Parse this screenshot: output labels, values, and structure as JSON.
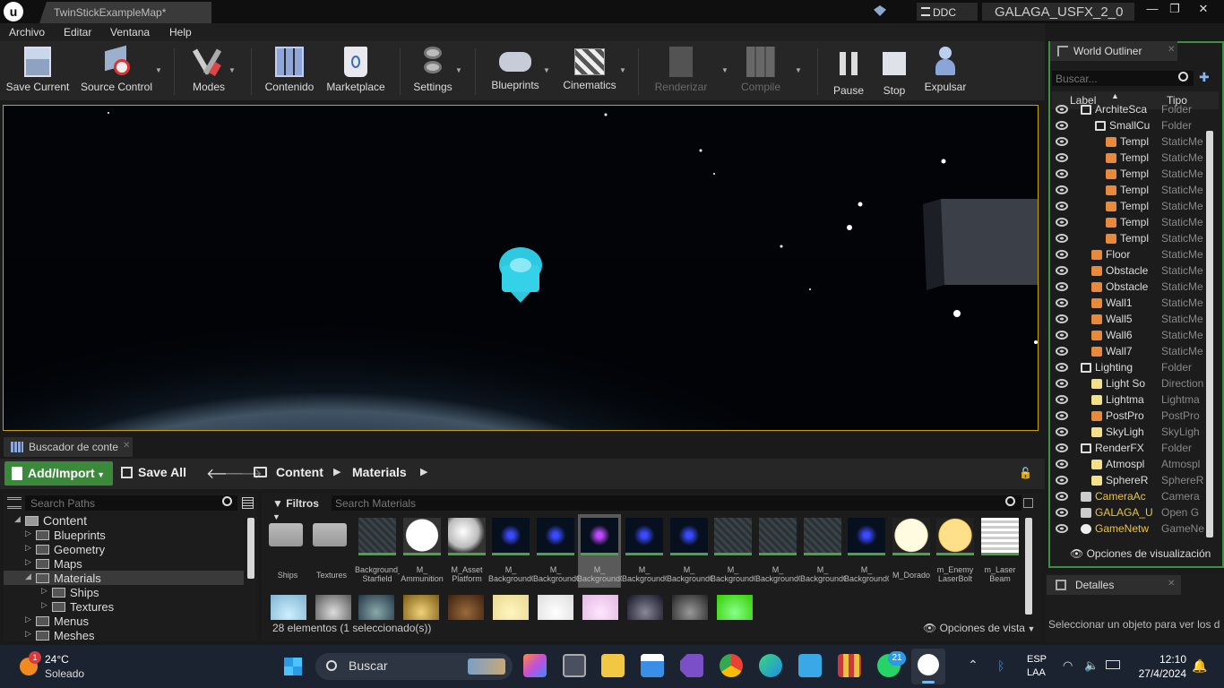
{
  "window": {
    "tab_title": "TwinStickExampleMap*",
    "ddc_label": "DDC",
    "project_name": "GALAGA_USFX_2_0",
    "minimize": "—",
    "maximize": "❐",
    "close": "✕"
  },
  "menu": [
    "Archivo",
    "Editar",
    "Ventana",
    "Help"
  ],
  "toolbar": {
    "save_current": "Save Current",
    "source_control": "Source Control",
    "modes": "Modes",
    "contenido": "Contenido",
    "marketplace": "Marketplace",
    "settings": "Settings",
    "blueprints": "Blueprints",
    "cinematics": "Cinematics",
    "renderizar": "Renderizar",
    "compile": "Compile",
    "pause": "Pause",
    "stop": "Stop",
    "expulsar": "Expulsar"
  },
  "content_browser": {
    "tab_label": "Buscador de conte",
    "add_import": "Add/Import",
    "save_all": "Save All",
    "breadcrumb": [
      "Content",
      "Materials"
    ],
    "search_paths_placeholder": "Search Paths",
    "filters_label": "Filtros",
    "search_materials_placeholder": "Search Materials",
    "tree": [
      {
        "label": "Content",
        "level": 0,
        "selected": false
      },
      {
        "label": "Blueprints",
        "level": 1,
        "selected": false
      },
      {
        "label": "Geometry",
        "level": 1,
        "selected": false
      },
      {
        "label": "Maps",
        "level": 1,
        "selected": false
      },
      {
        "label": "Materials",
        "level": 1,
        "selected": true
      },
      {
        "label": "Ships",
        "level": 2,
        "selected": false
      },
      {
        "label": "Textures",
        "level": 2,
        "selected": false
      },
      {
        "label": "Menus",
        "level": 1,
        "selected": false
      },
      {
        "label": "Meshes",
        "level": 1,
        "selected": false
      }
    ],
    "assets": [
      {
        "l1": "Ships",
        "l2": "",
        "kind": "folder"
      },
      {
        "l1": "Textures",
        "l2": "",
        "kind": "folder"
      },
      {
        "l1": "Background_",
        "l2": "Starfield",
        "kind": "grid"
      },
      {
        "l1": "M_",
        "l2": "Ammunition",
        "kind": "white"
      },
      {
        "l1": "M_Asset",
        "l2": "Platform",
        "kind": "sphere"
      },
      {
        "l1": "M_",
        "l2": "Background0",
        "kind": "space"
      },
      {
        "l1": "M_",
        "l2": "Background02",
        "kind": "space"
      },
      {
        "l1": "M_",
        "l2": "Background0",
        "kind": "spaceSel"
      },
      {
        "l1": "M_",
        "l2": "Background04",
        "kind": "space"
      },
      {
        "l1": "M_",
        "l2": "Background05",
        "kind": "space"
      },
      {
        "l1": "M_",
        "l2": "Background06",
        "kind": "grid"
      },
      {
        "l1": "M_",
        "l2": "Background07",
        "kind": "grid"
      },
      {
        "l1": "M_",
        "l2": "Background08",
        "kind": "grid"
      },
      {
        "l1": "M_",
        "l2": "Background09",
        "kind": "space"
      },
      {
        "l1": "M_Dorado",
        "l2": "",
        "kind": "cream"
      },
      {
        "l1": "m_Enemy",
        "l2": "LaserBolt",
        "kind": "yellow"
      },
      {
        "l1": "m_Laser",
        "l2": "Beam",
        "kind": "stripe"
      }
    ],
    "status": "28 elementos (1 seleccionado(s))",
    "view_options": "Opciones de vista"
  },
  "outliner": {
    "tab_label": "World Outliner",
    "search_placeholder": "Buscar...",
    "col_label": "Label",
    "col_type": "Tipo",
    "rows": [
      {
        "label": "ArchiteSca",
        "type": "Folder",
        "indent": 48,
        "icon": "folder"
      },
      {
        "label": "SmallCu",
        "type": "Folder",
        "indent": 64,
        "icon": "folder"
      },
      {
        "label": "Templ",
        "type": "StaticMe",
        "indent": 76,
        "icon": "mesh"
      },
      {
        "label": "Templ",
        "type": "StaticMe",
        "indent": 76,
        "icon": "mesh"
      },
      {
        "label": "Templ",
        "type": "StaticMe",
        "indent": 76,
        "icon": "mesh"
      },
      {
        "label": "Templ",
        "type": "StaticMe",
        "indent": 76,
        "icon": "mesh"
      },
      {
        "label": "Templ",
        "type": "StaticMe",
        "indent": 76,
        "icon": "mesh"
      },
      {
        "label": "Templ",
        "type": "StaticMe",
        "indent": 76,
        "icon": "mesh"
      },
      {
        "label": "Templ",
        "type": "StaticMe",
        "indent": 76,
        "icon": "mesh"
      },
      {
        "label": "Floor",
        "type": "StaticMe",
        "indent": 60,
        "icon": "mesh"
      },
      {
        "label": "Obstacle",
        "type": "StaticMe",
        "indent": 60,
        "icon": "mesh"
      },
      {
        "label": "Obstacle",
        "type": "StaticMe",
        "indent": 60,
        "icon": "mesh"
      },
      {
        "label": "Wall1",
        "type": "StaticMe",
        "indent": 60,
        "icon": "mesh"
      },
      {
        "label": "Wall5",
        "type": "StaticMe",
        "indent": 60,
        "icon": "mesh"
      },
      {
        "label": "Wall6",
        "type": "StaticMe",
        "indent": 60,
        "icon": "mesh"
      },
      {
        "label": "Wall7",
        "type": "StaticMe",
        "indent": 60,
        "icon": "mesh"
      },
      {
        "label": "Lighting",
        "type": "Folder",
        "indent": 48,
        "icon": "folder"
      },
      {
        "label": "Light So",
        "type": "Direction",
        "indent": 60,
        "icon": "light"
      },
      {
        "label": "Lightma",
        "type": "Lightma",
        "indent": 60,
        "icon": "light"
      },
      {
        "label": "PostPro",
        "type": "PostPro",
        "indent": 60,
        "icon": "mesh"
      },
      {
        "label": "SkyLigh",
        "type": "SkyLigh",
        "indent": 60,
        "icon": "light"
      },
      {
        "label": "RenderFX",
        "type": "Folder",
        "indent": 48,
        "icon": "folder"
      },
      {
        "label": "Atmospl",
        "type": "Atmospl",
        "indent": 60,
        "icon": "light"
      },
      {
        "label": "SphereR",
        "type": "SphereR",
        "indent": 60,
        "icon": "light"
      },
      {
        "label": "CameraAc",
        "type": "Camera",
        "indent": 48,
        "icon": "camera",
        "color": "#e8c34a"
      },
      {
        "label": "GALAGA_U",
        "type": "Open G",
        "indent": 48,
        "icon": "camera",
        "color": "#e8c34a"
      },
      {
        "label": "GameNetw",
        "type": "GameNe",
        "indent": 48,
        "icon": "sphere",
        "color": "#e8c34a"
      }
    ],
    "view_options": "Opciones de visualización"
  },
  "details": {
    "tab_label": "Detalles",
    "message": "Seleccionar un objeto para ver los d"
  },
  "taskbar": {
    "weather_temp": "24°C",
    "weather_desc": "Soleado",
    "weather_badge": "1",
    "search_label": "Buscar",
    "whatsapp_badge": "21",
    "lang_top": "ESP",
    "lang_bottom": "LAA",
    "time": "12:10",
    "date": "27/4/2024"
  }
}
